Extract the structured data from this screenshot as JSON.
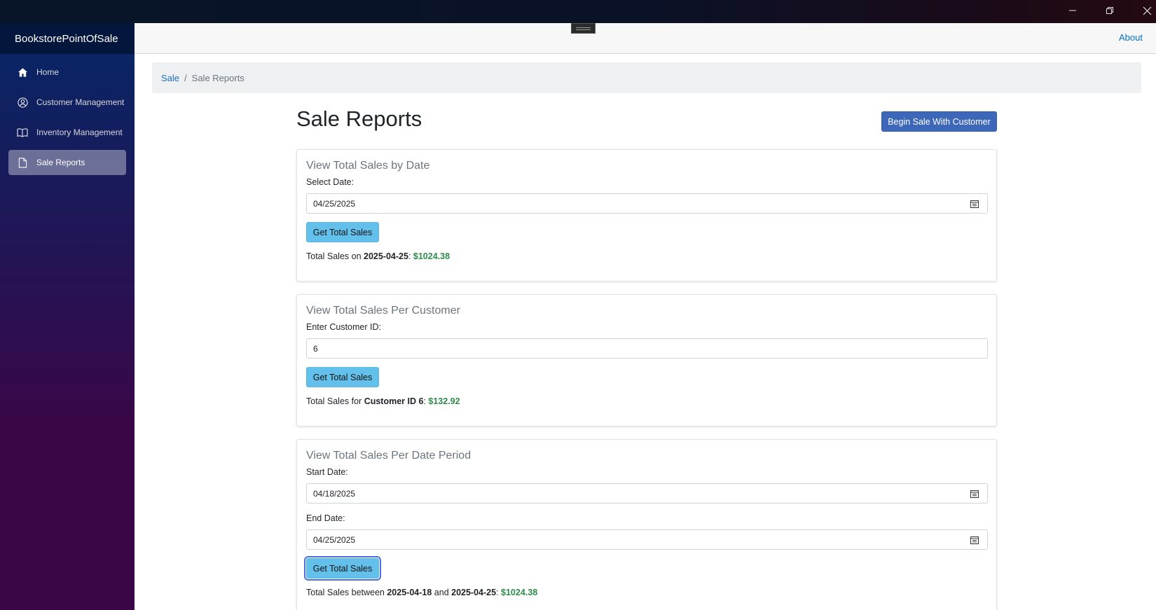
{
  "window": {
    "minimize_icon": "minimize-icon",
    "maximize_icon": "restore-icon",
    "close_icon": "close-icon"
  },
  "sidebar": {
    "brand": "BookstorePointOfSale",
    "items": [
      {
        "label": "Home",
        "icon": "home-icon"
      },
      {
        "label": "Customer Management",
        "icon": "person-circle-icon"
      },
      {
        "label": "Inventory Management",
        "icon": "book-icon"
      },
      {
        "label": "Sale Reports",
        "icon": "document-icon",
        "active": true
      }
    ]
  },
  "top_row": {
    "about": "About"
  },
  "breadcrumb": {
    "link": "Sale",
    "separator": "/",
    "current": "Sale Reports"
  },
  "page": {
    "title": "Sale Reports",
    "begin_sale_button": "Begin Sale With Customer"
  },
  "by_date": {
    "title": "View Total Sales by Date",
    "label": "Select Date:",
    "value": "04/25/2025",
    "button": "Get Total Sales",
    "result_prefix": "Total Sales on ",
    "result_key": "2025-04-25",
    "result_colon": ": ",
    "result_amount": "$1024.38"
  },
  "per_customer": {
    "title": "View Total Sales Per Customer",
    "label": "Enter Customer ID:",
    "value": "6",
    "button": "Get Total Sales",
    "result_prefix": "Total Sales for ",
    "result_key": "Customer ID 6",
    "result_colon": ": ",
    "result_amount": "$132.92"
  },
  "per_period": {
    "title": "View Total Sales Per Date Period",
    "start_label": "Start Date:",
    "start_value": "04/18/2025",
    "end_label": "End Date:",
    "end_value": "04/25/2025",
    "button": "Get Total Sales",
    "result_prefix": "Total Sales between ",
    "result_start": "2025-04-18",
    "result_and": " and ",
    "result_end": "2025-04-25",
    "result_colon": ": ",
    "result_amount": "$1024.38"
  },
  "colors": {
    "accent_button": "#3d68b9",
    "info_button": "#63c0ea",
    "amount": "#2e8b4a",
    "link": "#1b6ec2"
  }
}
